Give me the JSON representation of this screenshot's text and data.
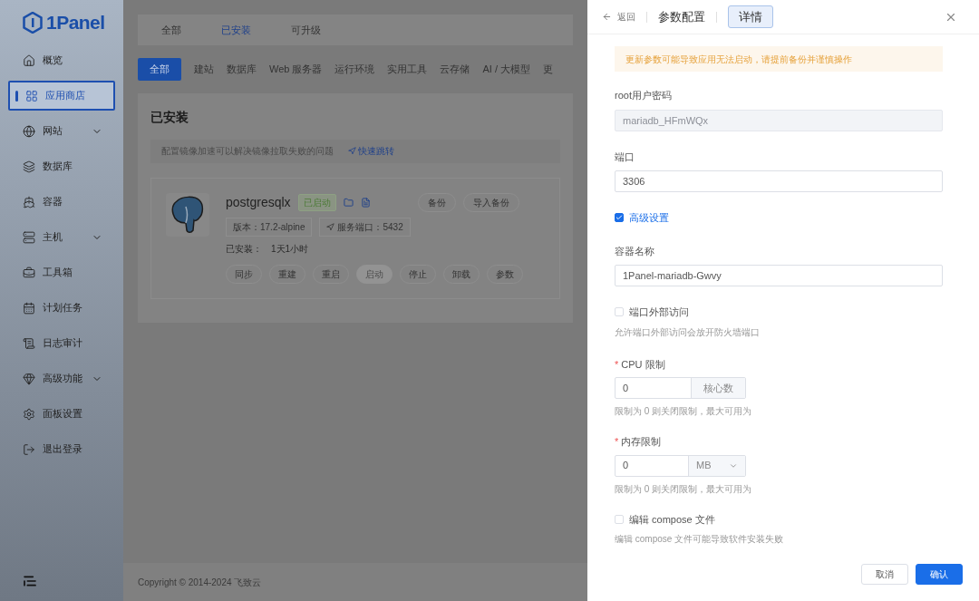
{
  "sidebar": {
    "logo": "1Panel",
    "items": [
      {
        "label": "概览",
        "selected": false,
        "expandable": false
      },
      {
        "label": "应用商店",
        "selected": true,
        "expandable": false
      },
      {
        "label": "网站",
        "selected": false,
        "expandable": true
      },
      {
        "label": "数据库",
        "selected": false,
        "expandable": false
      },
      {
        "label": "容器",
        "selected": false,
        "expandable": false
      },
      {
        "label": "主机",
        "selected": false,
        "expandable": true
      },
      {
        "label": "工具箱",
        "selected": false,
        "expandable": false
      },
      {
        "label": "计划任务",
        "selected": false,
        "expandable": false
      },
      {
        "label": "日志审计",
        "selected": false,
        "expandable": false
      },
      {
        "label": "高级功能",
        "selected": false,
        "expandable": true
      },
      {
        "label": "面板设置",
        "selected": false,
        "expandable": false
      },
      {
        "label": "退出登录",
        "selected": false,
        "expandable": false
      }
    ]
  },
  "top_tabs": [
    {
      "label": "全部",
      "selected": false
    },
    {
      "label": "已安装",
      "selected": true
    },
    {
      "label": "可升级",
      "selected": false
    }
  ],
  "category_tabs": [
    {
      "label": "全部",
      "selected": true
    },
    {
      "label": "建站",
      "selected": false
    },
    {
      "label": "数据库",
      "selected": false
    },
    {
      "label": "Web 服务器",
      "selected": false
    },
    {
      "label": "运行环境",
      "selected": false
    },
    {
      "label": "实用工具",
      "selected": false
    },
    {
      "label": "云存储",
      "selected": false
    },
    {
      "label": "AI / 大模型",
      "selected": false
    },
    {
      "label": "更",
      "selected": false
    }
  ],
  "installed": {
    "title": "已安装",
    "notice": "配置镜像加速可以解决镜像拉取失败的问题",
    "notice_link": "快速跳转",
    "app": {
      "name": "postgresqlx",
      "status": "已启动",
      "version": "版本：17.2-alpine",
      "port": "服务端口：5432",
      "installed_label": "已安装：",
      "installed_value": "1天1小时",
      "top_actions": [
        "备份",
        "导入备份"
      ],
      "actions": [
        {
          "label": "同步",
          "disabled": false
        },
        {
          "label": "重建",
          "disabled": false
        },
        {
          "label": "重启",
          "disabled": false
        },
        {
          "label": "启动",
          "disabled": true
        },
        {
          "label": "停止",
          "disabled": false
        },
        {
          "label": "卸载",
          "disabled": false
        },
        {
          "label": "参数",
          "disabled": false
        }
      ]
    }
  },
  "footer": "Copyright © 2014-2024 飞致云",
  "drawer": {
    "back": "返回",
    "title": "参数配置",
    "tab": {
      "label": "详情",
      "selected": true
    },
    "alert": "更新参数可能导致应用无法启动，请提前备份并谨慎操作",
    "fields": [
      {
        "kind": "input",
        "label": "root用户密码",
        "value": "mariadb_HFmWQx",
        "disabled": true
      },
      {
        "kind": "input",
        "label": "端口",
        "value": "3306",
        "disabled": false
      },
      {
        "kind": "checkbox",
        "label": "高级设置",
        "checked": true
      },
      {
        "kind": "input",
        "label": "容器名称",
        "value": "1Panel-mariadb-Gwvy",
        "disabled": false
      },
      {
        "kind": "checkbox",
        "label": "端口外部访问",
        "checked": false,
        "hint": "允许端口外部访问会放开防火墙端口"
      },
      {
        "kind": "suffix",
        "label": "CPU 限制",
        "required_mark": "*",
        "value": "0",
        "suffix": "核心数",
        "hint": "限制为 0 则关闭限制，最大可用为"
      },
      {
        "kind": "select",
        "label": "内存限制",
        "required_mark": "*",
        "value": "0",
        "suffix": "MB",
        "hint": "限制为 0 则关闭限制，最大可用为"
      },
      {
        "kind": "checkbox",
        "label": "编辑 compose 文件",
        "checked": false,
        "hint": "编辑 compose 文件可能导致软件安装失败"
      }
    ],
    "buttons": [
      {
        "label": "取消",
        "primary": false
      },
      {
        "label": "确认",
        "primary": true
      }
    ]
  }
}
